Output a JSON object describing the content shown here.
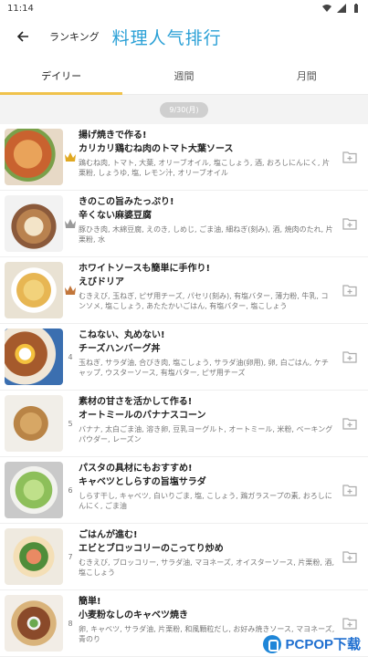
{
  "status": {
    "time": "11:14"
  },
  "header": {
    "subtitle": "ランキング",
    "title": "料理人气排行"
  },
  "tabs": [
    {
      "label": "デイリー",
      "active": true
    },
    {
      "label": "週間",
      "active": false
    },
    {
      "label": "月間",
      "active": false
    }
  ],
  "date_label": "9/30(月)",
  "items": [
    {
      "rank": "1",
      "crown": "gold",
      "line1": "揚げ焼きで作る!",
      "line2": "カリカリ鶏むね肉のトマト大葉ソース",
      "ingredients": "鶏むね肉, トマト, 大葉, オリーブオイル, 塩こしょう, 酒, おろしにんにく, 片栗粉, しょうゆ, 塩, レモン汁, オリーブオイル"
    },
    {
      "rank": "2",
      "crown": "silver",
      "line1": "きのこの旨みたっぷり!",
      "line2": "辛くない麻婆豆腐",
      "ingredients": "豚ひき肉, 木綿豆腐, えのき, しめじ, ごま油, 細ねぎ(刻み), 酒, 焼肉のたれ, 片栗粉, 水"
    },
    {
      "rank": "3",
      "crown": "bronze",
      "line1": "ホワイトソースも簡単に手作り!",
      "line2": "えびドリア",
      "ingredients": "むきえび, 玉ねぎ, ピザ用チーズ, パセリ(刻み), 有塩バター, 薄力粉, 牛乳, コンソメ, 塩こしょう, あたたかいごはん, 有塩バター, 塩こしょう"
    },
    {
      "rank": "4",
      "crown": "",
      "line1": "こねない、丸めない!",
      "line2": "チーズハンバーグ丼",
      "ingredients": "玉ねぎ, サラダ油, 合びき肉, 塩こしょう, サラダ油(卵用), 卵, 白ごはん, ケチャップ, ウスターソース, 有塩バター, ピザ用チーズ"
    },
    {
      "rank": "5",
      "crown": "",
      "line1": "素材の甘さを活かして作る!",
      "line2": "オートミールのバナナスコーン",
      "ingredients": "バナナ, 太白ごま油, 溶き卵, 豆乳ヨーグルト, オートミール, 米粉, ベーキングパウダー, レーズン"
    },
    {
      "rank": "6",
      "crown": "",
      "line1": "パスタの具材にもおすすめ!",
      "line2": "キャベツとしらすの旨塩サラダ",
      "ingredients": "しらす干し, キャベツ, 白いりごま, 塩, こしょう, 鶏ガラスープの素, おろしにんにく, ごま油"
    },
    {
      "rank": "7",
      "crown": "",
      "line1": "ごはんが進む!",
      "line2": "エビとブロッコリーのこってり炒め",
      "ingredients": "むきえび, ブロッコリー, サラダ油, マヨネーズ, オイスターソース, 片栗粉, 酒, 塩こしょう"
    },
    {
      "rank": "8",
      "crown": "",
      "line1": "簡単!",
      "line2": "小麦粉なしのキャベツ焼き",
      "ingredients": "卵, キャベツ, サラダ油, 片栗粉, 和風顆粒だし, お好み焼きソース, マヨネーズ, 青のり"
    }
  ],
  "watermark": "PCPOP下载",
  "colors": {
    "accent": "#2aa0d6",
    "tab_indicator": "#f0c24b",
    "gold": "#e0a821",
    "silver": "#9a9a9a",
    "bronze": "#c2763a"
  }
}
